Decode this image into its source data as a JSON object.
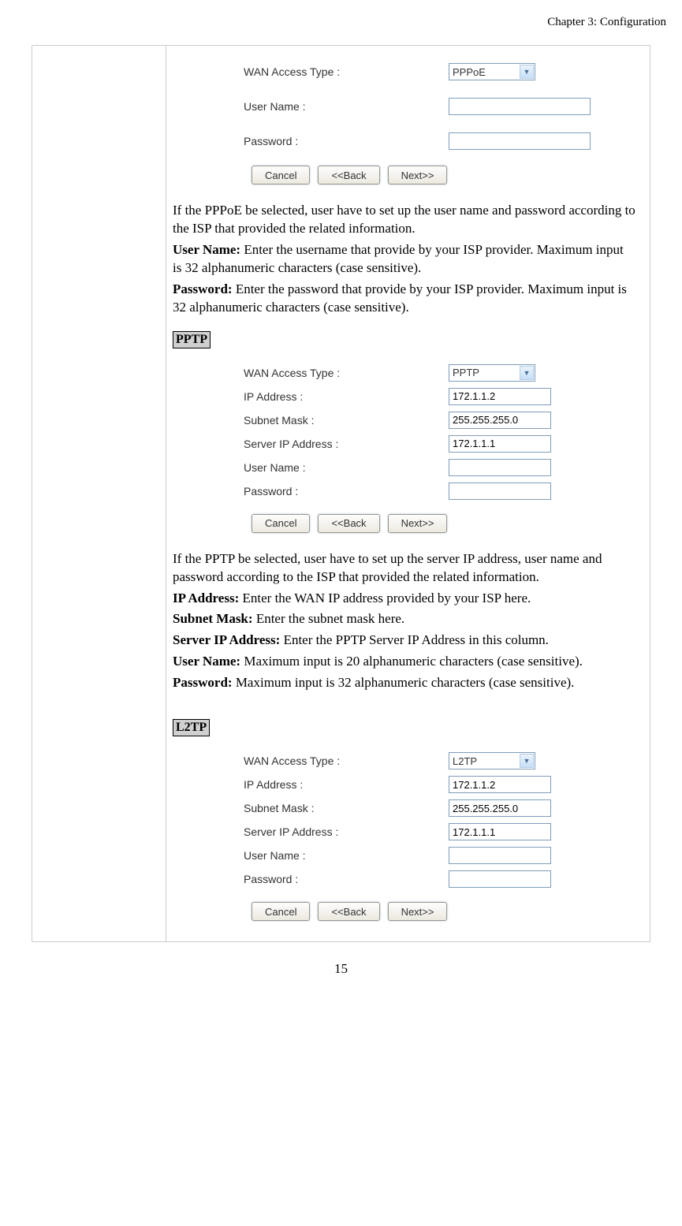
{
  "chapter": "Chapter 3: Configuration",
  "page_number": "15",
  "labels": {
    "wan_access_type": "WAN Access Type :",
    "user_name": "User Name :",
    "password": "Password :",
    "ip_address": "IP Address :",
    "subnet_mask": "Subnet Mask :",
    "server_ip": "Server IP Address :"
  },
  "buttons": {
    "cancel": "Cancel",
    "back": "<<Back",
    "next": "Next>>"
  },
  "pppoe": {
    "select_value": "PPPoE",
    "user_name_value": "",
    "password_value": "",
    "desc1": "If the PPPoE be selected, user have to set up the user name and password according to the ISP that provided the related information.",
    "desc2_b": "User Name:",
    "desc2": " Enter the username that provide by your ISP provider. Maximum input is 32 alphanumeric characters (case sensitive).",
    "desc3_b": "Password:",
    "desc3": " Enter the password that provide by your ISP provider. Maximum input is 32 alphanumeric characters (case sensitive)."
  },
  "pptp": {
    "tag": "PPTP",
    "select_value": "PPTP",
    "ip_value": "172.1.1.2",
    "subnet_value": "255.255.255.0",
    "server_ip_value": "172.1.1.1",
    "user_name_value": "",
    "password_value": "",
    "desc1": "If the PPTP be selected, user have to set up the server IP address, user name and password according to the ISP that provided the related information.",
    "desc2_b": "IP Address:",
    "desc2": " Enter the WAN IP address provided by your ISP here.",
    "desc3_b": "Subnet Mask:",
    "desc3": " Enter the subnet mask here.",
    "desc4_b": "Server IP Address:",
    "desc4": " Enter the PPTP Server IP Address in this column.",
    "desc5_b": "User Name:",
    "desc5": " Maximum input is 20 alphanumeric characters (case sensitive).",
    "desc6_b": "Password:",
    "desc6": " Maximum input is 32 alphanumeric characters (case sensitive)."
  },
  "l2tp": {
    "tag": "L2TP",
    "select_value": "L2TP",
    "ip_value": "172.1.1.2",
    "subnet_value": "255.255.255.0",
    "server_ip_value": "172.1.1.1",
    "user_name_value": "",
    "password_value": ""
  }
}
